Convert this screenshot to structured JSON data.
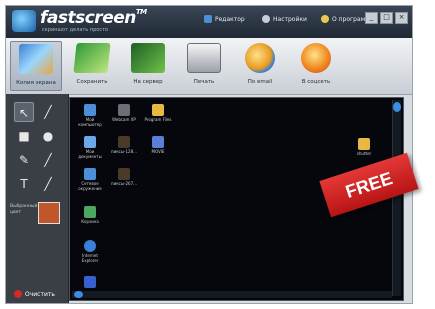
{
  "app": {
    "brand": "fastscreen",
    "trademark": "TM",
    "slogan": "скриншот делать просто",
    "accent": "#3d8ee0"
  },
  "titlebar": {
    "menu": [
      {
        "label": "Редактор",
        "icon": "editor-icon"
      },
      {
        "label": "Настройки",
        "icon": "settings-icon"
      },
      {
        "label": "О программе",
        "icon": "info-icon"
      }
    ],
    "window_buttons": [
      "_",
      "□",
      "×"
    ]
  },
  "toolbar": {
    "buttons": [
      {
        "label": "Копия экрана",
        "icon": "camera-screen-icon",
        "active": true
      },
      {
        "label": "Сохранить",
        "icon": "save-icon"
      },
      {
        "label": "На сервер",
        "icon": "server-upload-icon"
      },
      {
        "label": "Печать",
        "icon": "printer-icon"
      },
      {
        "label": "По email",
        "icon": "email-globe-icon"
      },
      {
        "label": "В соцсеть",
        "icon": "social-chat-icon"
      }
    ]
  },
  "tools": {
    "items": [
      "pointer",
      "pencil",
      "rectangle",
      "ellipse",
      "brush",
      "line",
      "text",
      "marker"
    ],
    "color_label": "Выбранный цвет",
    "color_value": "#c0572a",
    "clear_label": "Очистить"
  },
  "desktop": {
    "icons": [
      {
        "label": "Мой компьютер",
        "color": "#4a8fd8"
      },
      {
        "label": "Webcam XP",
        "color": "#6a6f76"
      },
      {
        "label": "Program Files",
        "color": "#e8b840"
      },
      {
        "label": "Мои документы",
        "color": "#6aa8e8"
      },
      {
        "label": "пиксы-128...",
        "color": "#4a3a2a"
      },
      {
        "label": "MOVIE",
        "color": "#5a7fd8"
      },
      {
        "label": "Сетевое окружение",
        "color": "#4a8fd8"
      },
      {
        "label": "пиксы-267...",
        "color": "#4a3a2a"
      },
      {
        "label": "Корзина",
        "color": "#4aa860"
      },
      {
        "label": "Internet Explorer",
        "color": "#3a7fd8"
      },
      {
        "label": "",
        "color": "#3a5fd0"
      },
      {
        "label": "shutter",
        "color": "#e8b840"
      }
    ]
  },
  "banner": {
    "text": "FREE",
    "color": "#d22424"
  }
}
